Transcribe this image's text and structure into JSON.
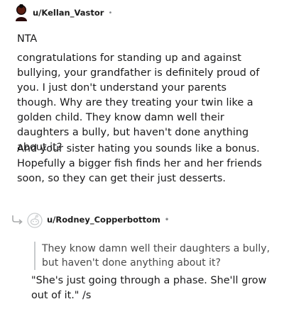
{
  "comment": {
    "username": "u/Kellan_Vastor",
    "separator": "•",
    "verdict": "NTA",
    "paragraphs": [
      "congratulations for standing up and against bullying, your grandfather is definitely proud of you. I just don't understand your parents though. Why are they treating your twin like a golden child. They know damn well their daughters a bully, but haven't done anything about it?",
      "And your sister hating you sounds like a bonus. Hopefully a bigger fish finds her and her friends soon, so they can get their just desserts."
    ]
  },
  "reply": {
    "username": "u/Rodney_Copperbottom",
    "separator": "•",
    "quote": "They know damn well their daughters a bully, but haven't done anything about it?",
    "text": "\"She's just going through a phase. She'll grow out of it.\" /s"
  },
  "colors": {
    "text": "#1a1a1b",
    "muted": "#878a8c",
    "quote_bar": "#c8cbcd"
  },
  "icons": {
    "comment_avatar": "user-avatar-icon",
    "reply_avatar": "default-snoo-avatar-icon",
    "reply_thread": "reply-arrow-icon"
  }
}
